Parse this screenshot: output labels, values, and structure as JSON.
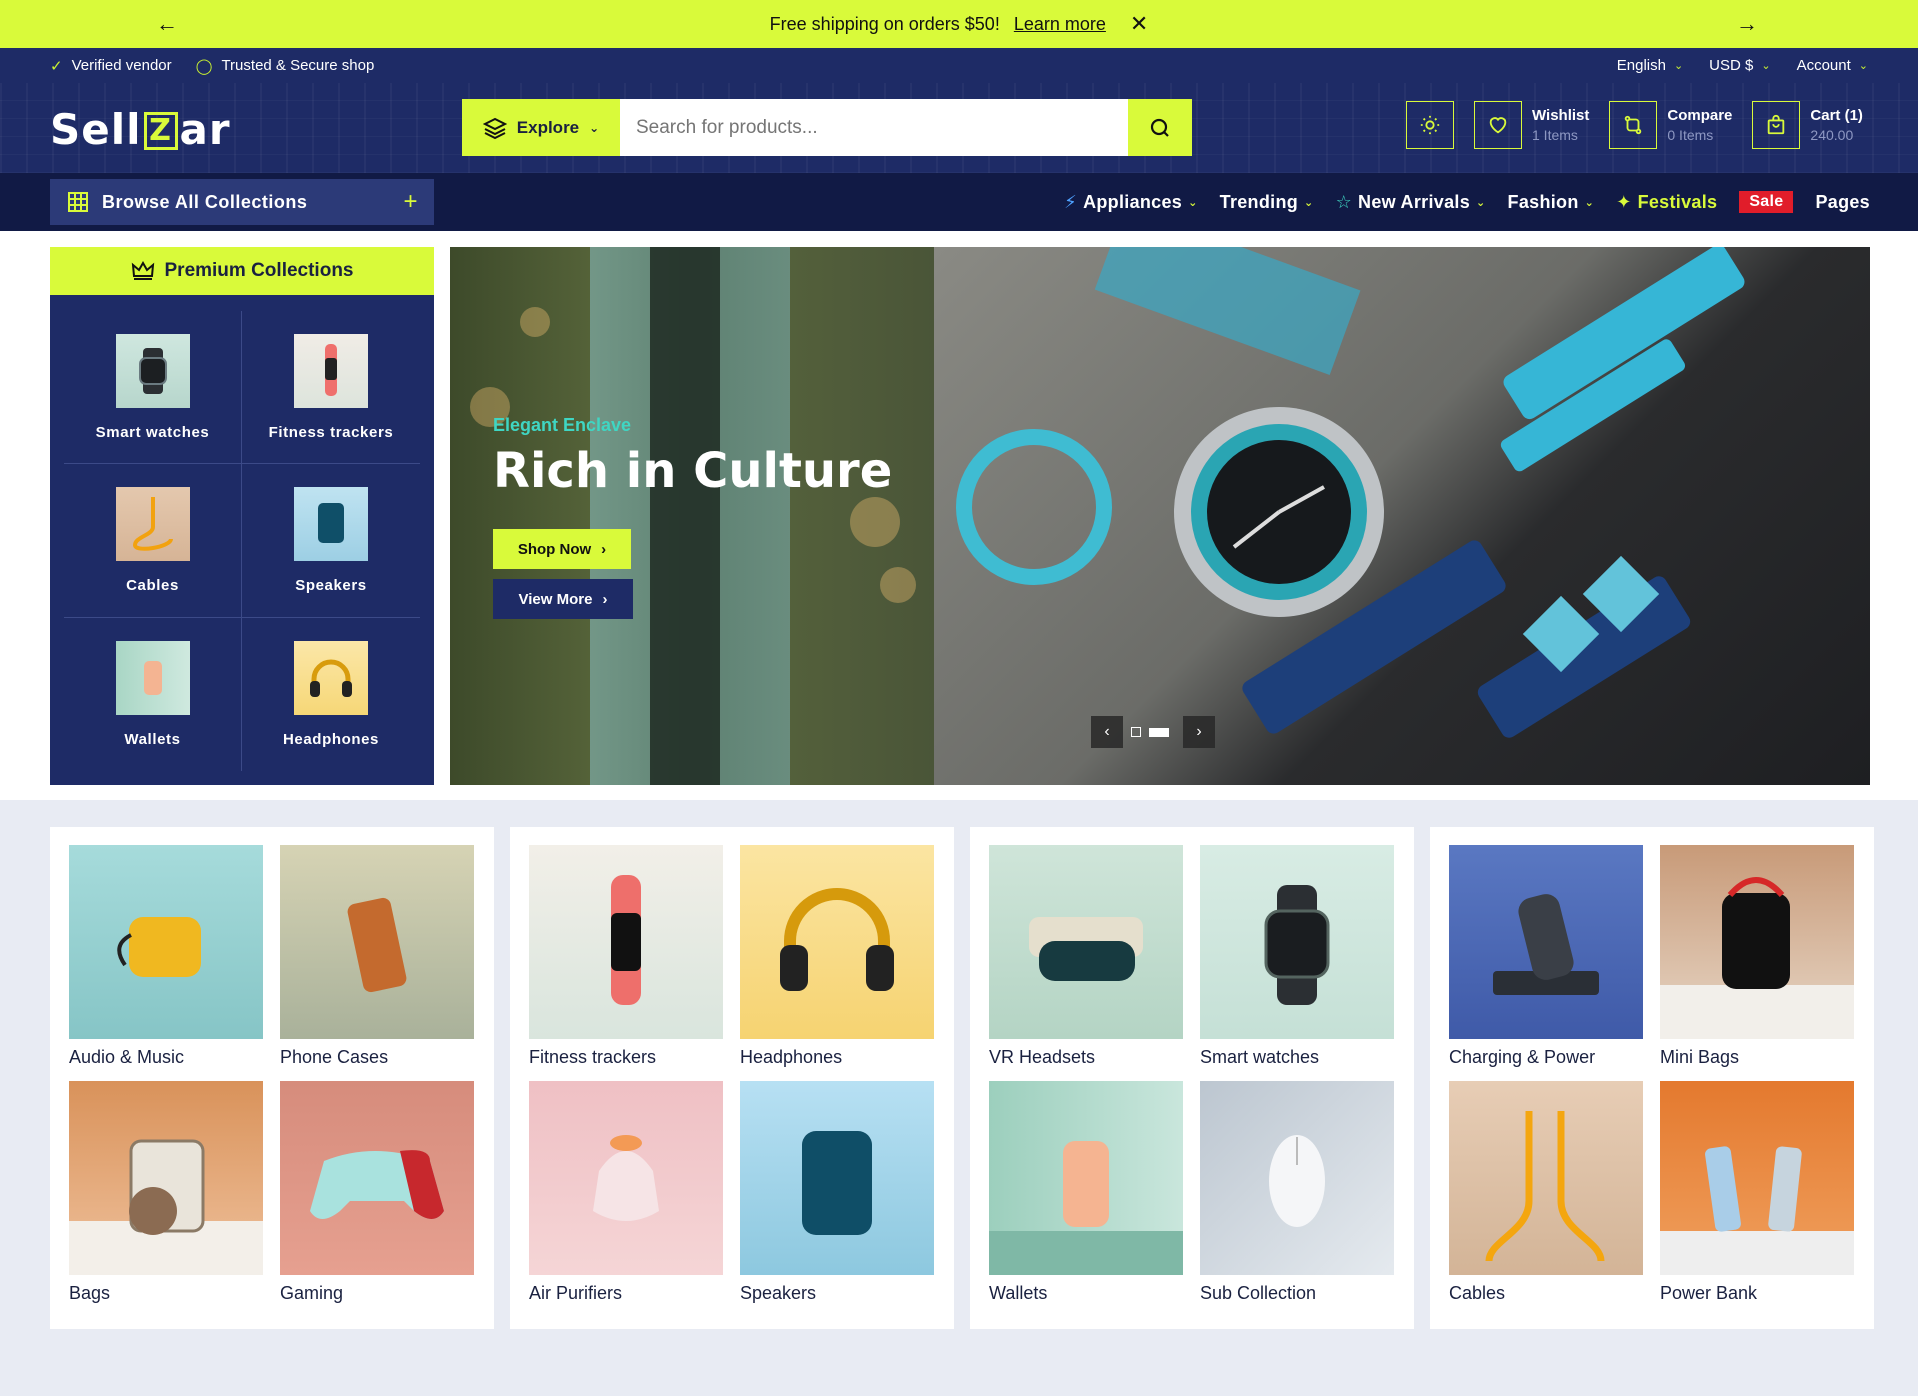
{
  "announcement": {
    "message": "Free shipping on orders $50!",
    "link": "Learn more"
  },
  "util_bar": {
    "badges": [
      "Verified vendor",
      "Trusted & Secure shop"
    ],
    "language": "English",
    "currency": "USD $",
    "account": "Account"
  },
  "header": {
    "logo": {
      "pre": "Sell",
      "mid": "Z",
      "post": "ar"
    },
    "explore_label": "Explore",
    "search_placeholder": "Search for products...",
    "wishlist": {
      "title": "Wishlist",
      "sub": "1 Items"
    },
    "compare": {
      "title": "Compare",
      "sub": "0 Items"
    },
    "cart": {
      "title": "Cart (1)",
      "sub": "240.00"
    }
  },
  "nav": {
    "browse_label": "Browse All Collections",
    "items": [
      {
        "label": "Appliances"
      },
      {
        "label": "Trending"
      },
      {
        "label": "New Arrivals"
      },
      {
        "label": "Fashion"
      },
      {
        "label": "Festivals"
      },
      {
        "label": "Sale"
      },
      {
        "label": "Pages"
      }
    ]
  },
  "premium": {
    "title": "Premium Collections",
    "items": [
      {
        "label": "Smart watches"
      },
      {
        "label": "Fitness trackers"
      },
      {
        "label": "Cables"
      },
      {
        "label": "Speakers"
      },
      {
        "label": "Wallets"
      },
      {
        "label": "Headphones"
      }
    ]
  },
  "hero": {
    "eyebrow": "Elegant Enclave",
    "title": "Rich in Culture",
    "primary_button": "Shop Now",
    "secondary_button": "View More"
  },
  "categories": [
    {
      "items": [
        {
          "label": "Audio & Music"
        },
        {
          "label": "Phone Cases"
        },
        {
          "label": "Bags"
        },
        {
          "label": "Gaming"
        }
      ]
    },
    {
      "items": [
        {
          "label": "Fitness trackers"
        },
        {
          "label": "Headphones"
        },
        {
          "label": "Air Purifiers"
        },
        {
          "label": "Speakers"
        }
      ]
    },
    {
      "items": [
        {
          "label": "VR Headsets"
        },
        {
          "label": "Smart watches"
        },
        {
          "label": "Wallets"
        },
        {
          "label": "Sub Collection"
        }
      ]
    },
    {
      "items": [
        {
          "label": "Charging & Power"
        },
        {
          "label": "Mini Bags"
        },
        {
          "label": "Cables"
        },
        {
          "label": "Power Bank"
        }
      ]
    }
  ],
  "colors": {
    "accent": "#d9fa3a",
    "navy": "#1e2b66",
    "dark_navy": "#111a45",
    "sale": "#e11d2a",
    "eyebrow": "#3fd6c3"
  }
}
